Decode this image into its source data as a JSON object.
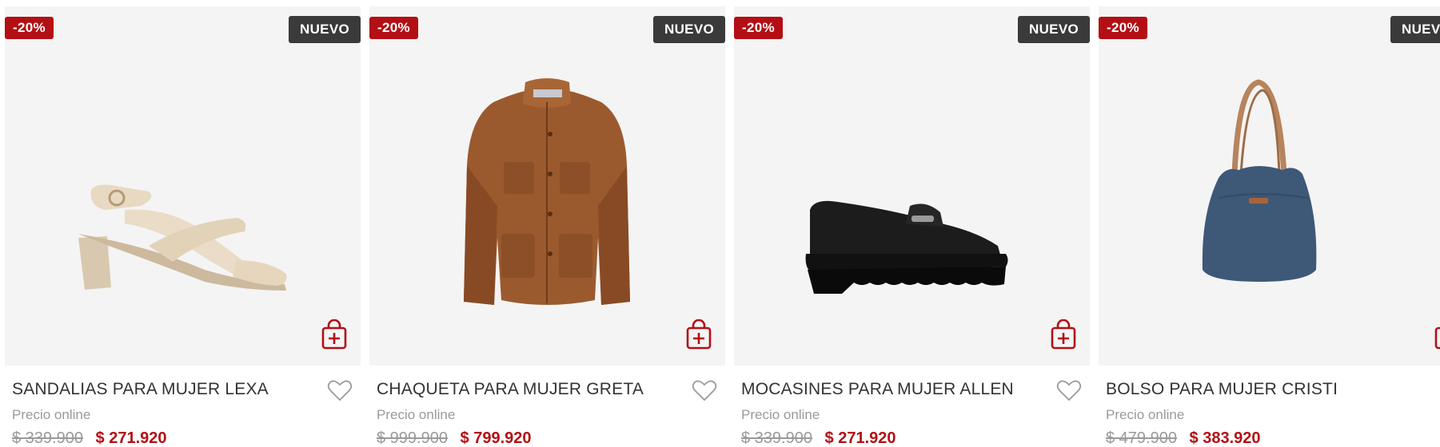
{
  "colors": {
    "accent": "#b30f14",
    "badge_dark": "#3a3a3a",
    "card_bg": "#f4f4f4",
    "muted": "#9a9a9a"
  },
  "products": [
    {
      "discount": "-20%",
      "badge": "NUEVO",
      "name": "SANDALIAS PARA MUJER LEXA",
      "price_label": "Precio online",
      "old_price": "$ 339.900",
      "price": "$ 271.920",
      "image_icon": "sandal-image"
    },
    {
      "discount": "-20%",
      "badge": "NUEVO",
      "name": "CHAQUETA PARA MUJER GRETA",
      "price_label": "Precio online",
      "old_price": "$ 999.900",
      "price": "$ 799.920",
      "image_icon": "jacket-image"
    },
    {
      "discount": "-20%",
      "badge": "NUEVO",
      "name": "MOCASINES PARA MUJER ALLEN",
      "price_label": "Precio online",
      "old_price": "$ 339.900",
      "price": "$ 271.920",
      "image_icon": "loafer-image"
    },
    {
      "discount": "-20%",
      "badge": "NUEVO",
      "name": "BOLSO PARA MUJER CRISTI",
      "price_label": "Precio online",
      "old_price": "$ 479.900",
      "price": "$ 383.920",
      "image_icon": "bag-image"
    }
  ]
}
